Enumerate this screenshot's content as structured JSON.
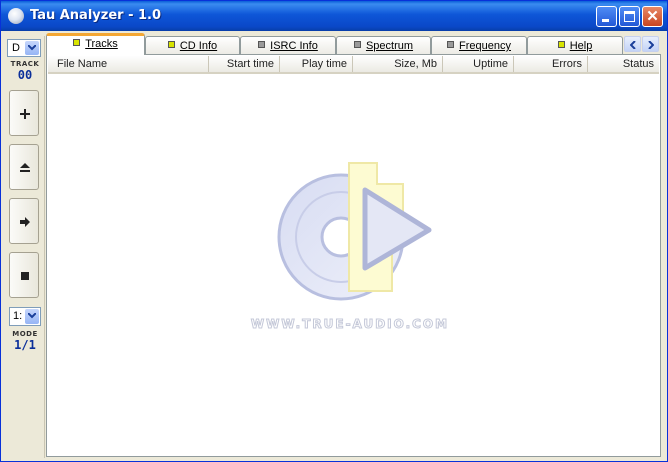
{
  "window": {
    "title": "Tau Analyzer - 1.0",
    "controls": [
      "minimize",
      "maximize",
      "close"
    ]
  },
  "left_panel": {
    "drive_select": {
      "value": "D"
    },
    "track_label": "TRACK",
    "track_value": "00",
    "buttons": [
      {
        "icon": "plus-icon"
      },
      {
        "icon": "eject-icon"
      },
      {
        "icon": "play-arrow-icon"
      },
      {
        "icon": "stop-icon"
      }
    ],
    "mode_select": {
      "value": "1:"
    },
    "mode_label": "MODE",
    "mode_value": "1/1"
  },
  "tabs": [
    {
      "label": "Tracks",
      "active": true,
      "indicator": "#d8e400"
    },
    {
      "label": "CD Info",
      "active": false,
      "indicator": "#d8e400"
    },
    {
      "label": "ISRC Info",
      "active": false,
      "indicator": "#9a9a9a"
    },
    {
      "label": "Spectrum",
      "active": false,
      "indicator": "#9a9a9a"
    },
    {
      "label": "Frequency",
      "active": false,
      "indicator": "#9a9a9a"
    },
    {
      "label": "Help",
      "active": false,
      "indicator": "#d8e400"
    }
  ],
  "table": {
    "columns": [
      "File Name",
      "Start time",
      "Play time",
      "Size, Mb",
      "Uptime",
      "Errors",
      "Status"
    ],
    "rows": []
  },
  "watermark": {
    "text": "WWW.TRUE-AUDIO.COM"
  },
  "colors": {
    "titlebar": "#0a48c8",
    "active_tab_accent": "#f4a733",
    "counter_text": "#0b2f9a"
  }
}
